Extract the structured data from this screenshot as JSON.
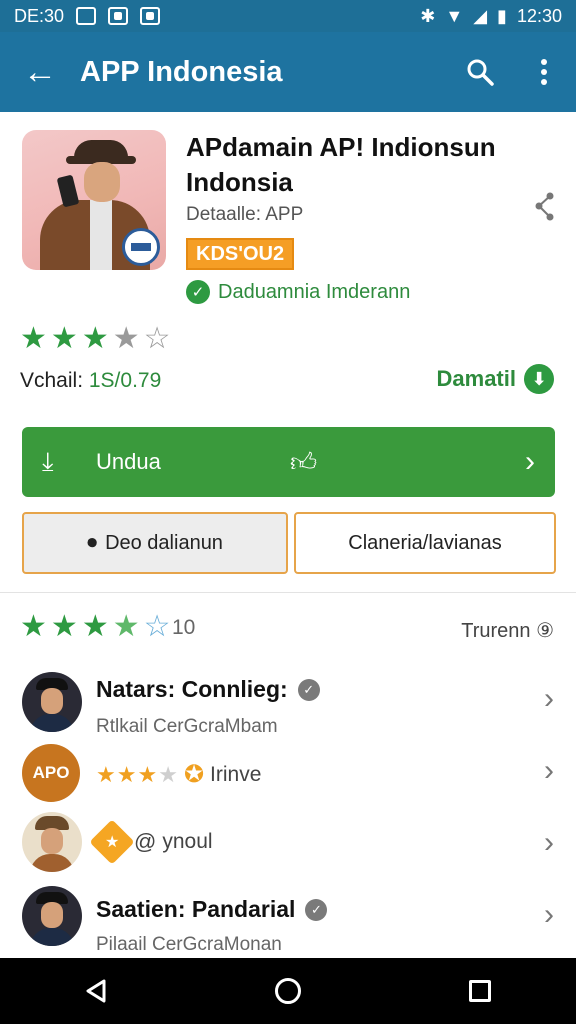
{
  "status_bar": {
    "time_left": "DE:30",
    "time_right": "12:30"
  },
  "app_bar": {
    "title": "APP Indonesia",
    "back_icon": "arrow-left-icon",
    "search_icon": "search-icon",
    "menu_icon": "more-vert-icon"
  },
  "app": {
    "name": "APdamain AP! Indionsun Indonsia",
    "subtitle": "Detaalle: APP",
    "tag": "KDS'OU2",
    "developer": "Daduamnia Imderann",
    "rating_stars": 3.5,
    "version_label": "Vchail:",
    "version_value": "1S/0.79",
    "download_link": "Damatil"
  },
  "buttons": {
    "install": "Undua",
    "secondary_left": "Deo dalianun",
    "secondary_right": "Claneria/lavianas"
  },
  "reviews": {
    "stars": 3.5,
    "count": "10",
    "right_label": "Trurenn ⑨",
    "items": [
      {
        "name": "Natars: Connlieg:",
        "subtitle": "Rtlkail CerGcraMbam",
        "avatar_text": ""
      },
      {
        "name": "",
        "subtitle": "",
        "avatar_text": "APO",
        "inline_text": "Irinve"
      },
      {
        "name": "",
        "subtitle": "",
        "avatar_text": "",
        "inline_text": "ynoul"
      },
      {
        "name": "Saatien: Pandarial",
        "subtitle": "Pilaail CerGcraMonan",
        "avatar_text": ""
      }
    ]
  },
  "colors": {
    "app_bar": "#1e73a0",
    "primary_green": "#3a9a3c",
    "accent_orange": "#f59e25",
    "outline_orange": "#e6a44a"
  }
}
